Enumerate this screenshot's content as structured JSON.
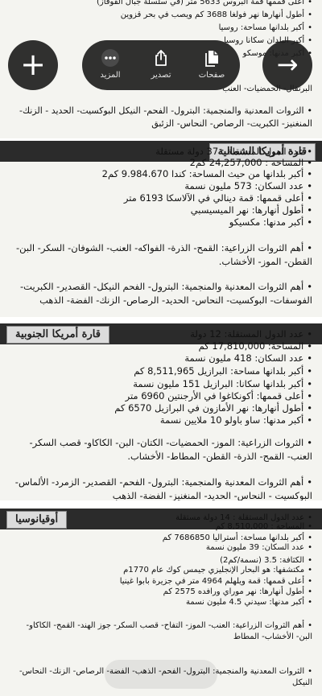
{
  "section0": {
    "lines": [
      "أعلى قممها قمة البروس 5633 متر (في سلسلة جبال القوقاز)",
      "أطول أنهارها نهر فولغا 3688 كم ويصب في بحر قزوين",
      "أكبر بلدانها مساحة: روسيا",
      "أكبر البلدان سكانا روسيا",
      "أكبر مدنها: موسكو",
      "البرتقال- الحمضيات- العنب"
    ],
    "para": "الثروات المعدنية والمنجمية: البترول- الفحم- النيكل البوكسيت- الحديد - الزنك- المنغنيز- الكبريت- الرصاص- النحاس- الزئبق"
  },
  "north_america": {
    "title": "قارة أمريكا الشمالية",
    "lines": [
      "عدد الدول المستقلة : 37 دولة مستقلة",
      "المساحة : 24,257,000 كم2",
      "أكبر بلدانها من حيث المساحة: كندا 9.984.670 كم2",
      "عدد السكان: 573 مليون نسمة",
      "أعلى قممها: قمة دينالي في الآلاسكا 6193 متر",
      "أطول أنهارها: نهر الميسيسبي",
      "أكبر مدنها: مكسيكو"
    ],
    "para1": "أهم الثروات الزراعية: القمح- الذرة- الفواكه- العنب- الشوفان- السكر- البن- القطن- الموز- الأخشاب.",
    "para2": "أهم الثروات المعدنية والمنجمية: البترول- الفحم النيكل- القصدير- الكبريت- الفوسفات- البوكسيت- النحاس- الحديد- الرصاص- الزنك- الفضة- الذهب"
  },
  "south_america": {
    "title": "قارة أمريكا الجنوبية",
    "lines": [
      "عدد الدول المستقلة: 12 دولة",
      "المساحة: 17,810,000 كم",
      "عدد السكان: 418 مليون نسمة",
      "أكبر بلدانها مساحة: البرازيل 8,511,965 كم",
      "أكبر بلدانها سكانا: البرازيل 151 مليون نسمة",
      "أعلى قممها: أكونكاغوا في الأرجنتين 6960 متر",
      "أطول أنهارها: نهر الأمازون في البرازيل 6570 كم",
      "أكبر مدنها: ساو باولو 10 ملايين نسمة"
    ],
    "para1": "الثروات الزراعية: الموز- الحمضيات- الكتان- البن- الكاكاو- قصب السكر- العنب- القمح- الذرة- القطن- المطاط- الأخشاب.",
    "para2": "أهم الثروات المعدنية والمنجمية: البترول- الفحم- القصدير- الزمرد- الألماس- البوكسيت - النحاس- الحديد- المنغنيز- الفضة- الذهب"
  },
  "oceania": {
    "title": "أوقيانوسيا",
    "lines": [
      "عدد الدول المستقلة : 14 دولة مستقلة",
      "المساحة : 8,510,000 كم",
      "أكبر بلدانها مساحة: أستراليا 7686850 كم",
      "عدد السكان: 39 مليون نسمة",
      "الكثافة: 3.5 (نسمة/كم2)",
      "مكتشفها: هو البحار الإنجليزي جيمس كوك عام 1770م",
      "أعلى قممها: قمة ويلهلم 4964 متر في جزيرة بابوا غينيا",
      "أطول أنهارها: نهر موراي ورافده 2575 كم",
      "أكبر مدنها: سيدني 4.5 مليون نسمة"
    ],
    "para1": "أهم الثروات الزراعية: العنب- الموز- التفاح- قصب السكر- جوز الهند- القمح- الكاكاو- البن- الأخشاب- المطاط",
    "para2": "الثروات المعدنية والمنجمية: البترول- الفحم- الذهب- الفضة- الرصاص- الزنك- النحاس- النيكل"
  },
  "toolbar": {
    "add_glyph": "+",
    "next_glyph": "→",
    "more_label": "المزيد",
    "export_label": "تصدير",
    "pages_label": "صفحات"
  },
  "icons": {
    "add": "plus-icon",
    "more": "ellipsis-icon",
    "export": "share-icon",
    "pages": "pages-icon",
    "next": "arrow-right-icon"
  },
  "colors": {
    "header_band": "#2b2b2b",
    "header_tab": "#dcdcdc",
    "toolbar": "#1e1e1e"
  }
}
